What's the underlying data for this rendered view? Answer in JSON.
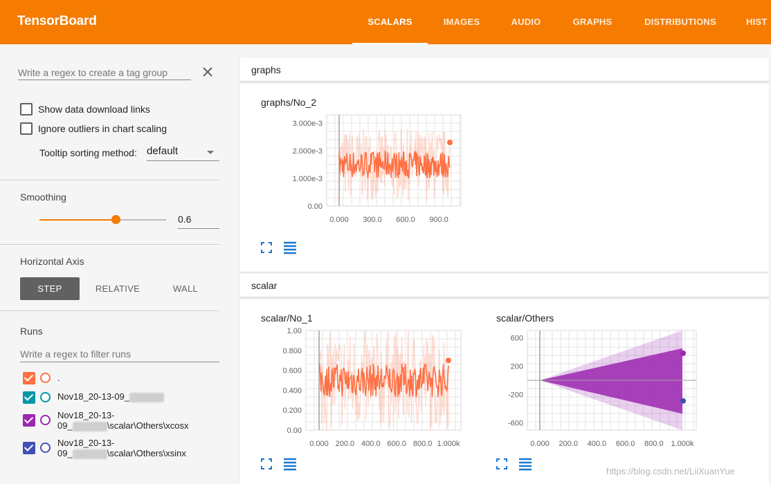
{
  "app": {
    "title": "TensorBoard"
  },
  "nav": {
    "tabs": [
      {
        "label": "SCALARS",
        "active": true
      },
      {
        "label": "IMAGES"
      },
      {
        "label": "AUDIO"
      },
      {
        "label": "GRAPHS"
      },
      {
        "label": "DISTRIBUTIONS"
      },
      {
        "label": "HIST"
      }
    ]
  },
  "sidebar": {
    "tag_regex_placeholder": "Write a regex to create a tag group",
    "show_download_links": "Show data download links",
    "ignore_outliers": "Ignore outliers in chart scaling",
    "tooltip_sort_label": "Tooltip sorting method:",
    "tooltip_sort_value": "default",
    "smoothing_title": "Smoothing",
    "smoothing_value": "0.6",
    "smoothing_fraction": 0.6,
    "horizontal_axis_title": "Horizontal Axis",
    "axis_options": [
      "STEP",
      "RELATIVE",
      "WALL"
    ],
    "axis_selected": "STEP",
    "runs_title": "Runs",
    "runs_filter_placeholder": "Write a regex to filter runs",
    "runs": [
      {
        "line1": ".",
        "line2": "",
        "color": "#ff7043"
      },
      {
        "line1": "Nov18_20-13-09_",
        "line2": "",
        "color": "#0097a7"
      },
      {
        "line1": "Nov18_20-13-",
        "line2": "\\scalar\\Others\\xcosx",
        "line2_prefix": "09_",
        "color": "#9c27b0"
      },
      {
        "line1": "Nov18_20-13-",
        "line2": "\\scalar\\Others\\xsinx",
        "line2_prefix": "09_",
        "color": "#3f51b5"
      }
    ]
  },
  "groups": {
    "graphs": {
      "name": "graphs",
      "card_title": "graphs/No_2"
    },
    "scalar": {
      "name": "scalar",
      "card1_title": "scalar/No_1",
      "card2_title": "scalar/Others"
    }
  },
  "watermark": "https://blog.csdn.net/LiiXuanYue",
  "chart_data": [
    {
      "type": "line",
      "title": "graphs/No_2",
      "x_ticks": [
        "0.000",
        "300.0",
        "600.0",
        "900.0"
      ],
      "y_ticks": [
        "0.00",
        "1.000e-3",
        "2.000e-3",
        "3.000e-3"
      ],
      "xlim": [
        0,
        1000
      ],
      "ylim": [
        0,
        0.0033
      ],
      "series": [
        {
          "color": "#ff7043",
          "smoothed_center": 0.0015,
          "smoothed_spread": 0.0005,
          "raw_spread": 0.0013,
          "last_value": 0.0023
        }
      ],
      "grid": true
    },
    {
      "type": "line",
      "title": "scalar/No_1",
      "x_ticks": [
        "0.000",
        "200.0",
        "400.0",
        "600.0",
        "800.0",
        "1.000k"
      ],
      "y_ticks": [
        "0.00",
        "0.200",
        "0.400",
        "0.600",
        "0.800",
        "1.00"
      ],
      "xlim": [
        0,
        1000
      ],
      "ylim": [
        0,
        1.0
      ],
      "series": [
        {
          "color": "#ff7043",
          "smoothed_center": 0.5,
          "smoothed_spread": 0.17,
          "raw_spread": 0.5,
          "last_value": 0.7
        }
      ],
      "grid": true
    },
    {
      "type": "area",
      "title": "scalar/Others",
      "x_ticks": [
        "0.000",
        "200.0",
        "400.0",
        "600.0",
        "800.0",
        "1.000k"
      ],
      "y_ticks": [
        "-600",
        "-200",
        "200",
        "600"
      ],
      "xlim": [
        0,
        1000
      ],
      "ylim": [
        -700,
        700
      ],
      "series": [
        {
          "color": "#9c27b0",
          "upper_end": 450,
          "raw_upper_end": 1000,
          "last_value": 380
        },
        {
          "color": "#3f51b5",
          "lower_end": -470,
          "raw_lower_end": -1000,
          "last_value": -290
        }
      ],
      "grid": true
    }
  ]
}
